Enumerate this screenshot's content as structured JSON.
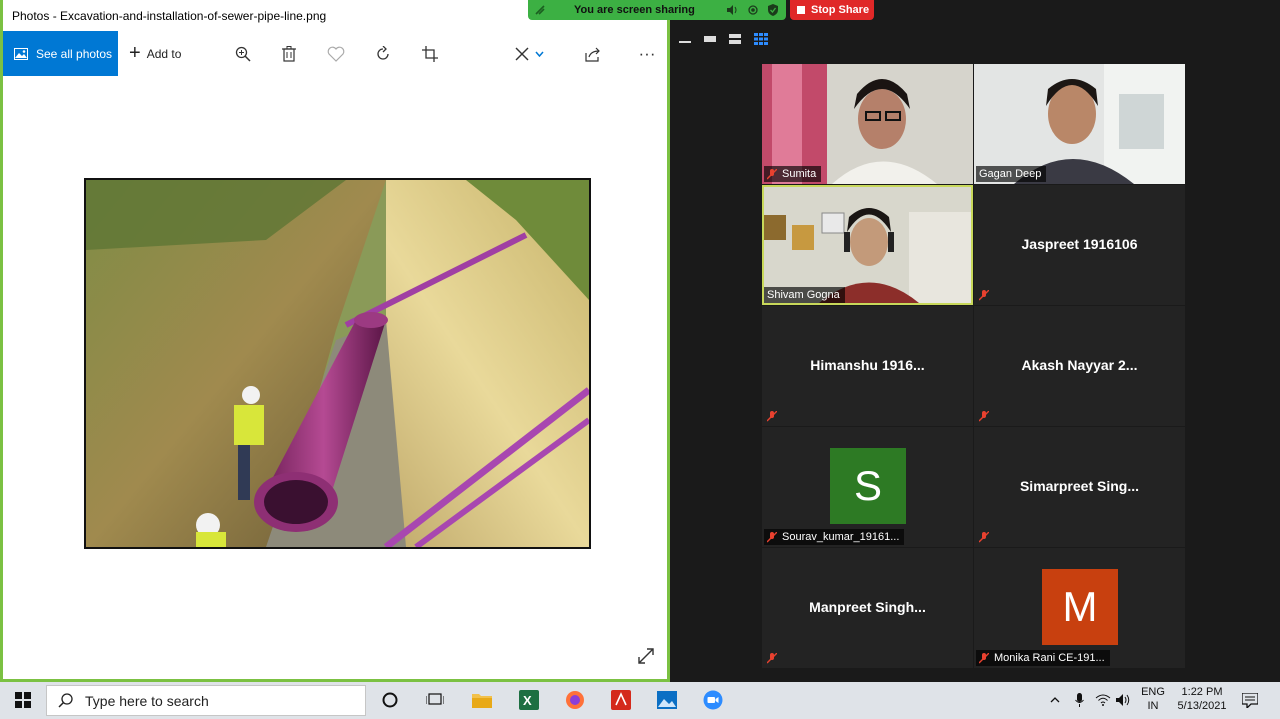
{
  "photos": {
    "title": "Photos - Excavation-and-installation-of-sewer-pipe-line.png",
    "see_all_label": "See all photos",
    "add_to_label": "Add to",
    "more_label": "···"
  },
  "share_bar": {
    "status": "You are screen sharing",
    "stop_label": "Stop Share"
  },
  "gallery": {
    "participants": [
      {
        "name": "Sumita",
        "video": true
      },
      {
        "name": "Gagan Deep",
        "video": true
      },
      {
        "name": "Shivam Gogna",
        "video": true,
        "active_speaker": true
      },
      {
        "name": "Jaspreet 1916106",
        "video": false
      },
      {
        "name": "Himanshu 1916...",
        "video": false
      },
      {
        "name": "Akash Nayyar 2...",
        "video": false
      },
      {
        "name": "Sourav_kumar_19161...",
        "video": false,
        "avatar_letter": "S",
        "avatar_color": "#2d7a24"
      },
      {
        "name": "Simarpreet  Sing...",
        "video": false
      },
      {
        "name": "Manpreet  Singh...",
        "video": false
      },
      {
        "name": "Monika Rani CE-191...",
        "video": false,
        "avatar_letter": "M",
        "avatar_color": "#c8400f"
      }
    ]
  },
  "taskbar": {
    "search_placeholder": "Type here to search",
    "lang_top": "ENG",
    "lang_bottom": "IN",
    "time": "1:22 PM",
    "date": "5/13/2021"
  },
  "colors": {
    "accent_blue": "#0078d4",
    "share_green": "#3cb043",
    "stop_red": "#e02828",
    "speaker_border": "#c8d85a"
  }
}
